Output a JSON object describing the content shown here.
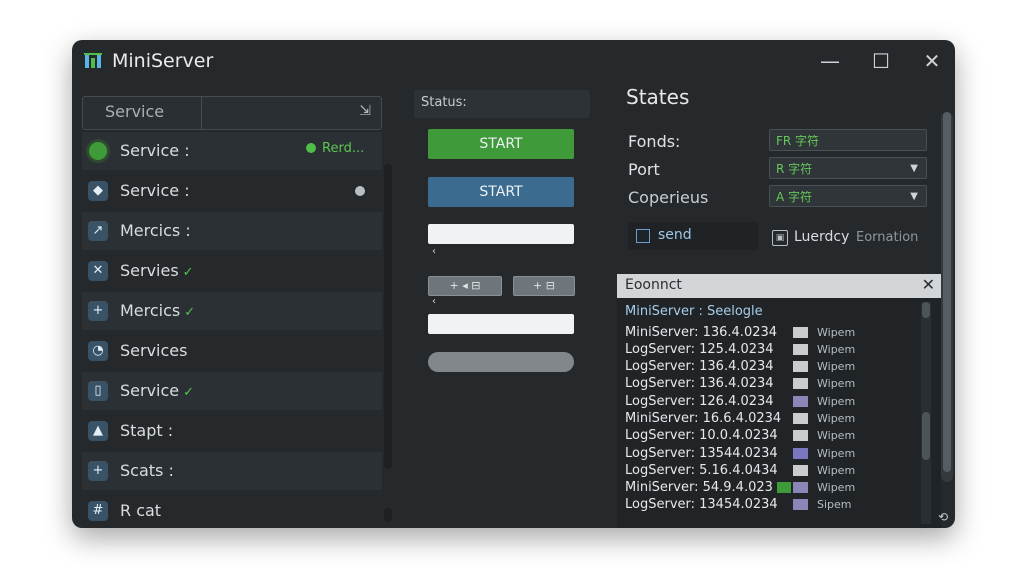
{
  "window": {
    "title": "MiniServer",
    "minimize": "—",
    "maximize": "☐",
    "close": "✕"
  },
  "sidebar": {
    "search_label": "Service",
    "pin_icon": "pin-icon",
    "items": [
      {
        "label": "Service :",
        "icon": "status-dot-icon",
        "status": "Rerd..."
      },
      {
        "label": "Service :",
        "icon": "globe-icon"
      },
      {
        "label": "Mercics :",
        "icon": "chart-icon"
      },
      {
        "label": "Servies",
        "icon": "tools-icon",
        "check": "✓"
      },
      {
        "label": "Mercics",
        "icon": "plus-icon",
        "check": "✓"
      },
      {
        "label": "Services",
        "icon": "clock-icon"
      },
      {
        "label": "Service",
        "icon": "document-icon",
        "check": "✓"
      },
      {
        "label": "Stapt :",
        "icon": "triangle-icon"
      },
      {
        "label": "Scats :",
        "icon": "plus-icon"
      },
      {
        "label": "R cat",
        "icon": "hash-icon"
      }
    ]
  },
  "middle": {
    "status_label": "Status:",
    "start_green": "START",
    "start_blue": "START",
    "toolbar_a": "+ ◂ ⊟",
    "toolbar_b": "+ ⊟"
  },
  "settings": {
    "title": "States",
    "rows": [
      {
        "label": "Fonds:",
        "value": "FR 字符"
      },
      {
        "label": "Port",
        "value": "R 字符",
        "dropdown": true
      },
      {
        "label": "Coperieus",
        "value": "A 字符",
        "dropdown": true
      }
    ],
    "send_label": "send",
    "luerday_label": "Luerdcy",
    "luerday_sub": "Eornation"
  },
  "log": {
    "header": "Eoonnct",
    "title_row": "MiniServer : Seelogle",
    "rows": [
      {
        "host": "MiniServer: 136.4.0234",
        "kind": "Wipem",
        "color": "#c9cdd0"
      },
      {
        "host": "LogServer: 125.4.0234",
        "kind": "Wipem",
        "color": "#c9cdd0"
      },
      {
        "host": "LogServer: 136.4.0234",
        "kind": "Wipem",
        "color": "#c9cdd0"
      },
      {
        "host": "LogServer: 136.4.0234",
        "kind": "Wipem",
        "color": "#c9cdd0"
      },
      {
        "host": "LogServer: 126.4.0234",
        "kind": "Wipem",
        "color": "#8a86b8"
      },
      {
        "host": "MiniServer: 16.6.4.0234",
        "kind": "Wipem",
        "color": "#c9cdd0"
      },
      {
        "host": "LogServer: 10.0.4.0234",
        "kind": "Wipem",
        "color": "#c9cdd0"
      },
      {
        "host": "LogServer: 13544.0234",
        "kind": "Wipem",
        "color": "#7a76c0"
      },
      {
        "host": "LogServer: 5.16.4.0434",
        "kind": "Wipem",
        "color": "#c9cdd0"
      },
      {
        "host": "MiniServer: 54.9.4.023",
        "kind": "Wipem",
        "color": "#8a86b8",
        "green": true
      },
      {
        "host": "LogServer: 13454.0234",
        "kind": "Sipem",
        "color": "#8a86b8"
      }
    ]
  }
}
